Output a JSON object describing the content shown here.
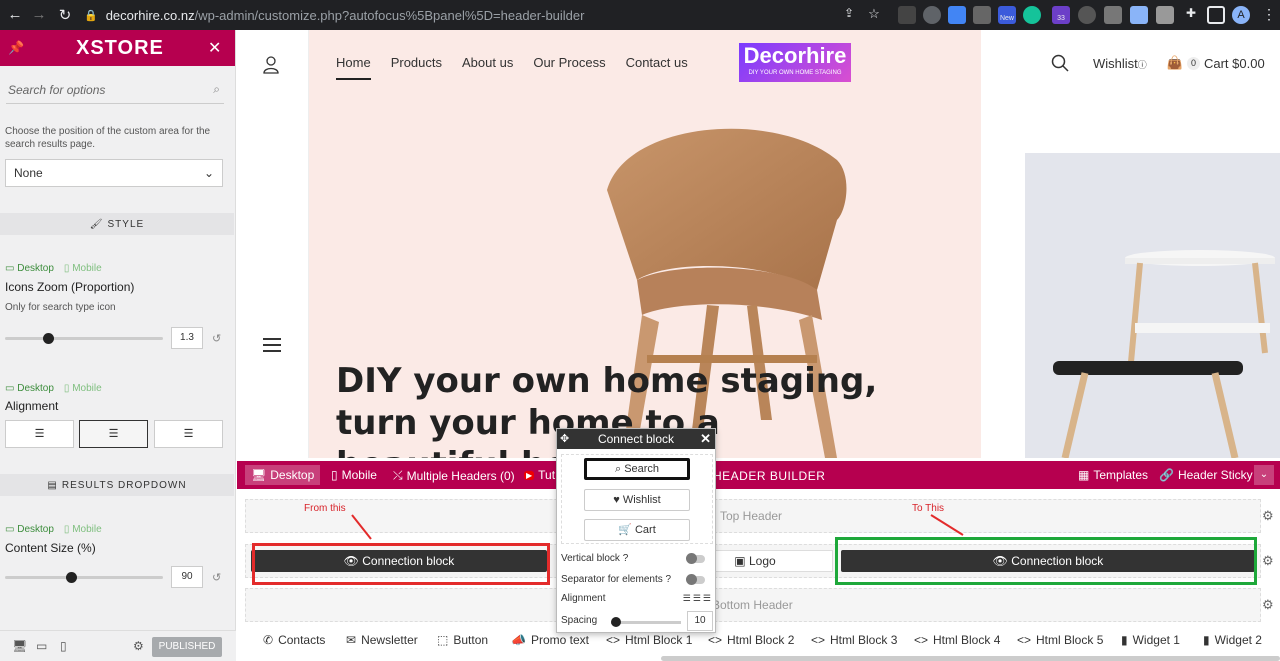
{
  "browser": {
    "url_host": "decorhire.co.nz",
    "url_path": "/wp-admin/customize.php?autofocus%5Bpanel%5D=header-builder",
    "profile_initial": "A",
    "ext_badge_new": "New",
    "ext_badge_count": "33"
  },
  "panel": {
    "brand": "XSTORE",
    "search_placeholder": "Search for options",
    "custom_area_desc": "Choose the position of the custom area for the search results page.",
    "position_select_value": "None",
    "style_section": "STYLE",
    "device_desktop": "Desktop",
    "device_mobile": "Mobile",
    "icons_zoom_label": "Icons Zoom (Proportion)",
    "icons_zoom_desc": "Only for search type icon",
    "icons_zoom_value": "1.3",
    "icons_zoom_fraction": 0.27,
    "alignment_label": "Alignment",
    "results_section": "RESULTS DROPDOWN",
    "content_size_label": "Content Size (%)",
    "content_size_value": "90",
    "content_size_fraction": 0.42,
    "published_label": "PUBLISHED"
  },
  "site": {
    "nav": [
      "Home",
      "Products",
      "About us",
      "Our Process",
      "Contact us"
    ],
    "logo_main": "Decorhire",
    "logo_tag": "DIY YOUR OWN HOME STAGING",
    "wishlist": "Wishlist",
    "cart_count": "0",
    "cart_label": "Cart $0.00",
    "hero_line1": "DIY your own home staging,",
    "hero_line2": "turn your home to a",
    "hero_line3": "beautiful ho"
  },
  "builder": {
    "desktop": "Desktop",
    "mobile": "Mobile",
    "multiple_headers": "Multiple Headers (0)",
    "tutorials": "Tut",
    "title": "HEADER BUILDER",
    "title_visible": "HEADER BUILDER",
    "templates": "Templates",
    "header_sticky": "Header Sticky",
    "top_header": "Top Header",
    "bottom_header": "Bottom Header",
    "conn_block_left": "Connection block",
    "conn_block_right": "Connection block",
    "logo_chip": "Logo",
    "annot_from": "From this",
    "annot_to": "To This",
    "elements": [
      "Contacts",
      "Newsletter",
      "Button",
      "Promo text",
      "Html Block 1",
      "Html Block 2",
      "Html Block 3",
      "Html Block 4",
      "Html Block 5",
      "Widget 1",
      "Widget 2"
    ]
  },
  "popup": {
    "title": "Connect block",
    "items": [
      "Search",
      "Wishlist",
      "Cart"
    ],
    "vertical_block": "Vertical block ?",
    "separator": "Separator for elements ?",
    "alignment": "Alignment",
    "spacing": "Spacing",
    "spacing_value": "10"
  },
  "colors": {
    "brand": "#b6004f",
    "annotation_red": "#e32b2b",
    "annotation_green": "#1ea83a"
  }
}
